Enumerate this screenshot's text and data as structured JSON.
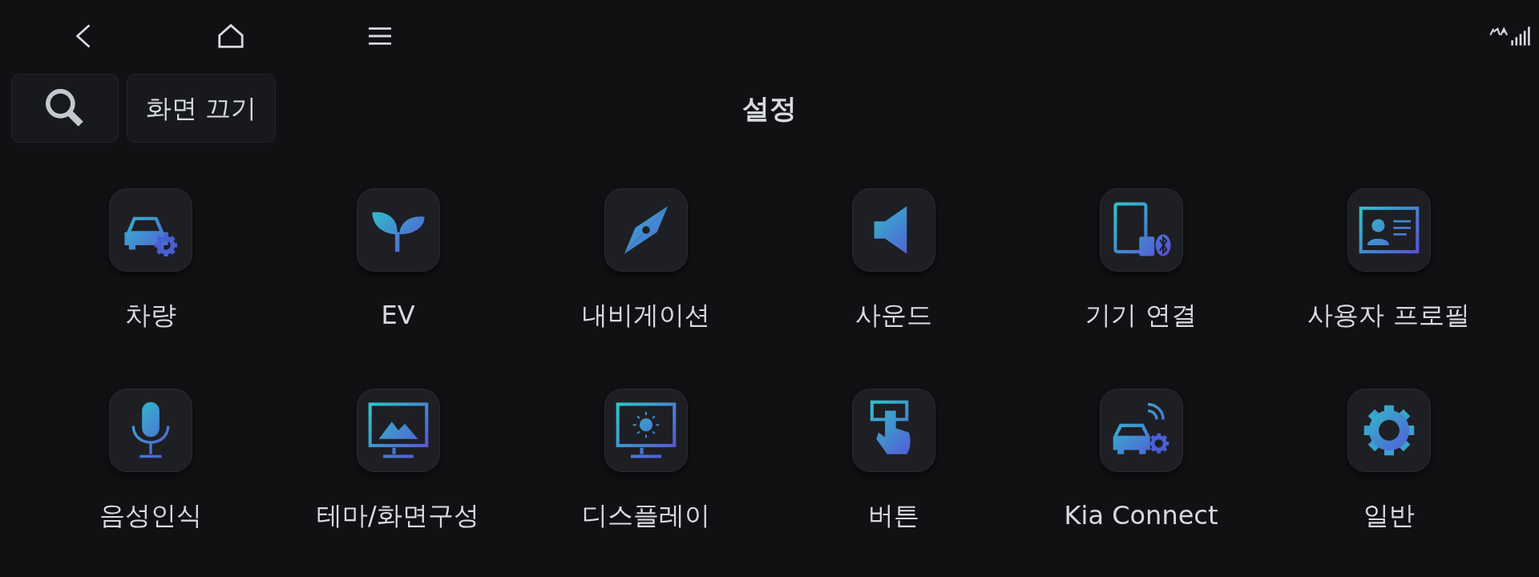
{
  "header": {
    "off_button": "화면 끄기",
    "title": "설정"
  },
  "items": [
    {
      "label": "차량",
      "kind": "vehicle"
    },
    {
      "label": "EV",
      "kind": "ev"
    },
    {
      "label": "내비게이션",
      "kind": "navigation"
    },
    {
      "label": "사운드",
      "kind": "sound"
    },
    {
      "label": "기기 연결",
      "kind": "devices"
    },
    {
      "label": "사용자 프로필",
      "kind": "profile"
    },
    {
      "label": "음성인식",
      "kind": "voice"
    },
    {
      "label": "테마/화면구성",
      "kind": "theme"
    },
    {
      "label": "디스플레이",
      "kind": "display"
    },
    {
      "label": "버튼",
      "kind": "button"
    },
    {
      "label": "Kia Connect",
      "kind": "connect"
    },
    {
      "label": "일반",
      "kind": "general"
    }
  ]
}
